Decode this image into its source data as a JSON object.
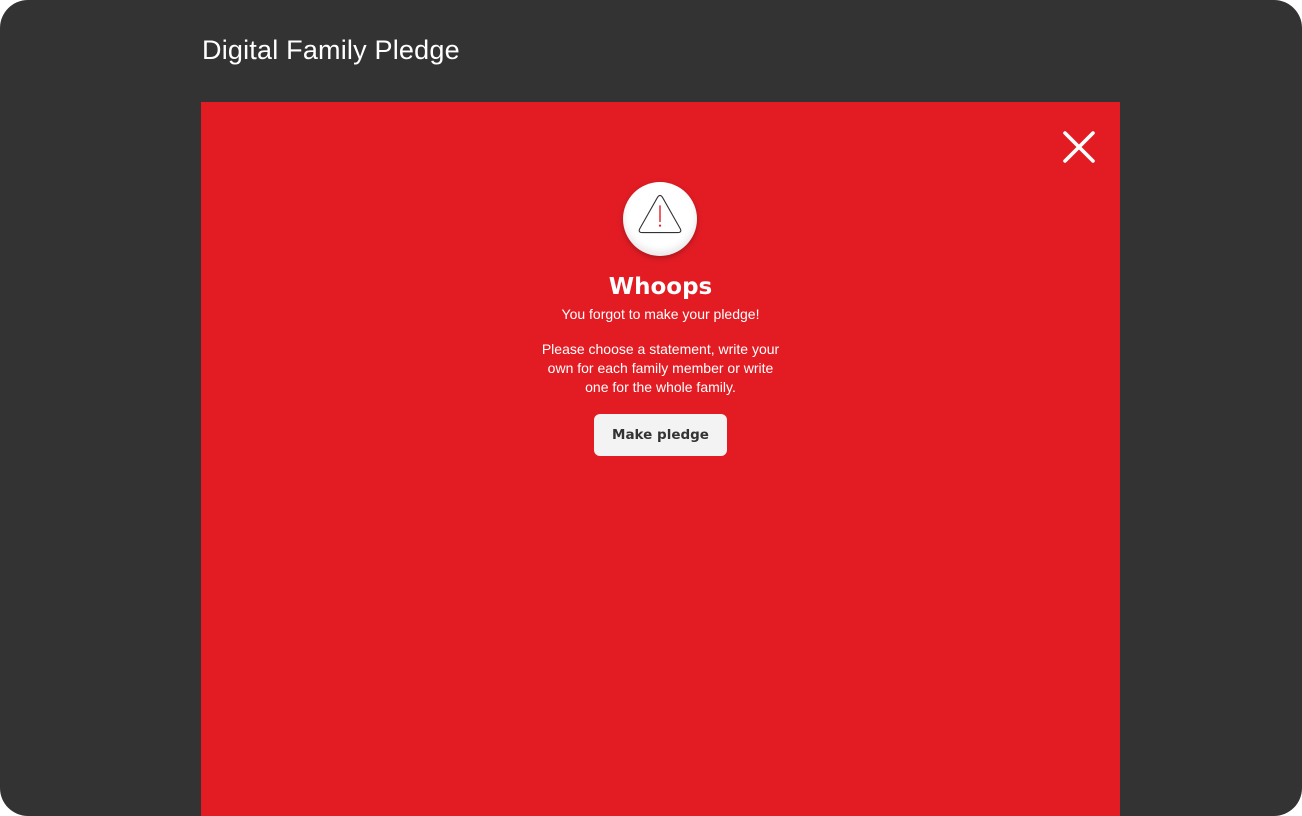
{
  "window": {
    "title": "Digital Family Pledge"
  },
  "modal": {
    "close_icon": "close-icon",
    "alert_icon": "warning-triangle-icon",
    "heading": "Whoops",
    "subheading": "You forgot to make your pledge!",
    "body_lines": [
      "Please choose a statement, write your",
      "own for each family member or write",
      "one for the whole family."
    ],
    "button_label": "Make pledge"
  },
  "colors": {
    "window_background": "#333333",
    "panel_background": "#e31c24",
    "button_background": "#f4f3f3",
    "button_text": "#333333",
    "text": "#ffffff",
    "warning_mark": "#e31c24"
  }
}
